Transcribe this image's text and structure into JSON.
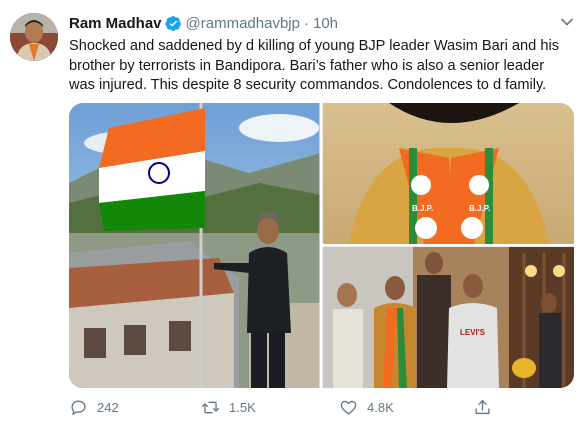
{
  "tweet": {
    "author_name": "Ram Madhav",
    "handle": "@rammadhavbjp",
    "separator": "·",
    "time": "10h",
    "text": "Shocked and saddened by d killing of young BJP leader Wasim Bari and his brother by terrorists in Bandipora. Bari’s father who is also a senior leader was injured. This despite 8 security commandos. Condolences to d family.",
    "scarf_label": "B.J.P.",
    "shirt_brand": "LEVI'S"
  },
  "actions": {
    "reply_count": "242",
    "retweet_count": "1.5K",
    "like_count": "4.8K"
  },
  "colors": {
    "accent": "#1da1f2",
    "muted": "#657786",
    "saffron": "#f26b21",
    "flag_green": "#138808"
  },
  "icons": [
    "verified-badge-icon",
    "chevron-down-icon",
    "reply-icon",
    "retweet-icon",
    "like-icon",
    "share-icon"
  ]
}
